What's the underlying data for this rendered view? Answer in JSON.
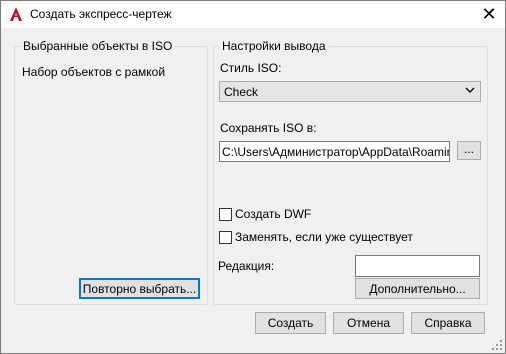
{
  "window": {
    "title": "Создать экспресс-чертеж",
    "app_icon": "autocad-icon",
    "close_icon": "close-icon",
    "close_glyph": "✕"
  },
  "left_group": {
    "title": "Выбранные объекты в ISO",
    "info_text": "Набор объектов с рамкой",
    "reselect_label": "Повторно выбрать..."
  },
  "right_group": {
    "title": "Настройки вывода",
    "style_label": "Стиль ISO:",
    "style_value": "Check",
    "save_label": "Сохранять ISO в:",
    "save_path": "C:\\Users\\Администратор\\AppData\\Roaming",
    "browse_label": "...",
    "create_dwf_label": "Создать DWF",
    "create_dwf_checked": false,
    "replace_label": "Заменять, если уже существует",
    "replace_checked": false,
    "revision_label": "Редакция:",
    "revision_value": "",
    "advanced_label": "Дополнительно..."
  },
  "footer": {
    "create_label": "Создать",
    "cancel_label": "Отмена",
    "help_label": "Справка"
  },
  "colors": {
    "accent": "#0078d7",
    "app_icon_red": "#c8102e"
  }
}
